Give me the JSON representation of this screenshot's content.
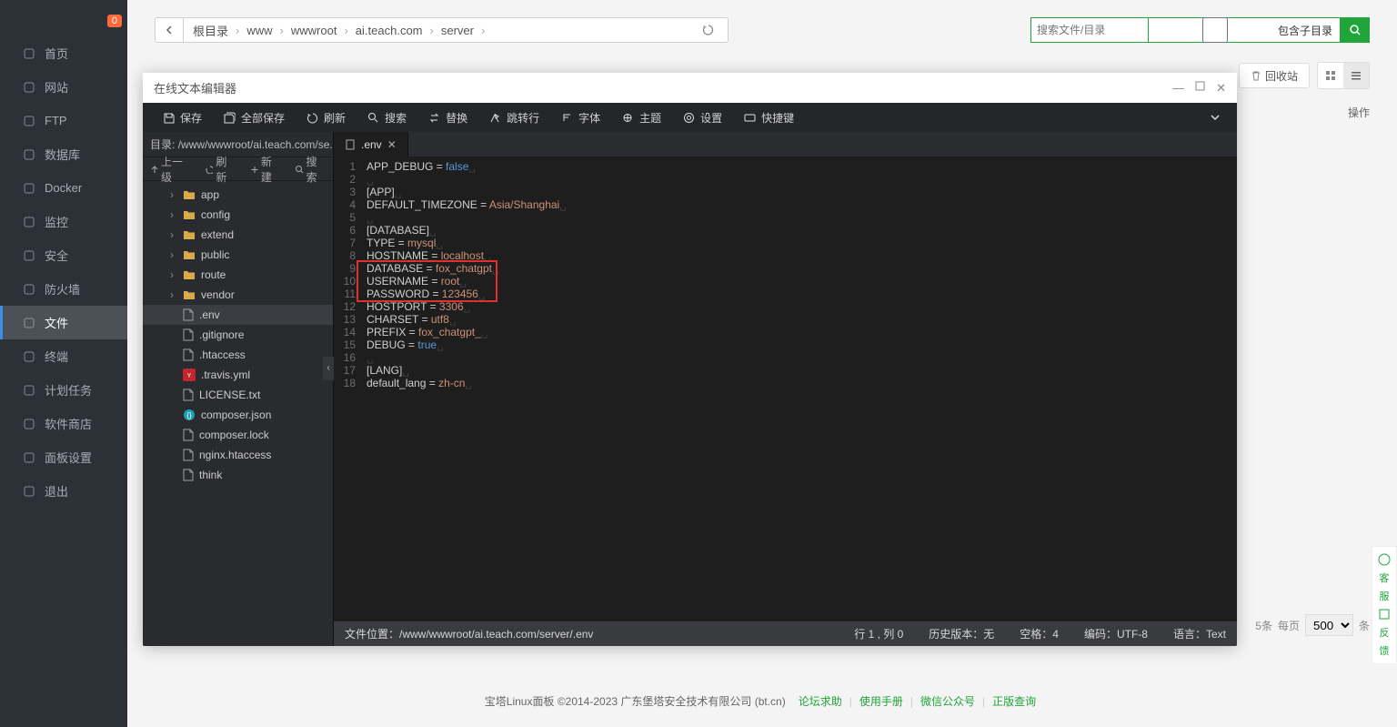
{
  "nav": {
    "badge": "0",
    "items": [
      {
        "label": "首页",
        "icon": "home-icon"
      },
      {
        "label": "网站",
        "icon": "globe-icon"
      },
      {
        "label": "FTP",
        "icon": "ftp-icon"
      },
      {
        "label": "数据库",
        "icon": "db-icon"
      },
      {
        "label": "Docker",
        "icon": "docker-icon"
      },
      {
        "label": "监控",
        "icon": "monitor-icon"
      },
      {
        "label": "安全",
        "icon": "shield-icon"
      },
      {
        "label": "防火墙",
        "icon": "firewall-icon"
      },
      {
        "label": "文件",
        "icon": "file-icon",
        "active": true
      },
      {
        "label": "终端",
        "icon": "terminal-icon"
      },
      {
        "label": "计划任务",
        "icon": "cron-icon"
      },
      {
        "label": "软件商店",
        "icon": "store-icon"
      },
      {
        "label": "面板设置",
        "icon": "settings-icon"
      },
      {
        "label": "退出",
        "icon": "logout-icon"
      }
    ]
  },
  "header": {
    "crumbs": [
      "根目录",
      "www",
      "wwwroot",
      "ai.teach.com",
      "server"
    ],
    "search_placeholder": "搜索文件/目录",
    "include_sub": "包含子目录"
  },
  "toolbar": {
    "trash": "回收站",
    "ops_label": "操作"
  },
  "footer_bar": {
    "count_suffix": "5条",
    "per_page_label": "每页",
    "per_page": "500",
    "unit": "条"
  },
  "copyright": {
    "text": "宝塔Linux面板 ©2014-2023 广东堡塔安全技术有限公司 (bt.cn)",
    "links": [
      "论坛求助",
      "使用手册",
      "微信公众号",
      "正版查询"
    ]
  },
  "feedback": [
    "客",
    "服",
    "反",
    "馈"
  ],
  "editor": {
    "title": "在线文本编辑器",
    "tools": [
      {
        "icon": "save-icon",
        "label": "保存"
      },
      {
        "icon": "save-all-icon",
        "label": "全部保存"
      },
      {
        "icon": "refresh-icon",
        "label": "刷新"
      },
      {
        "icon": "search-icon",
        "label": "搜索"
      },
      {
        "icon": "replace-icon",
        "label": "替换"
      },
      {
        "icon": "goto-icon",
        "label": "跳转行"
      },
      {
        "icon": "font-icon",
        "label": "字体"
      },
      {
        "icon": "theme-icon",
        "label": "主题"
      },
      {
        "icon": "settings-icon",
        "label": "设置"
      },
      {
        "icon": "hotkey-icon",
        "label": "快捷键"
      }
    ],
    "sidebar": {
      "path_label": "目录:",
      "path": "/www/wwwroot/ai.teach.com/se...",
      "ops": [
        "上一级",
        "刷新",
        "新建",
        "搜索"
      ],
      "tree": [
        {
          "type": "folder",
          "name": "app"
        },
        {
          "type": "folder",
          "name": "config"
        },
        {
          "type": "folder",
          "name": "extend"
        },
        {
          "type": "folder",
          "name": "public"
        },
        {
          "type": "folder",
          "name": "route"
        },
        {
          "type": "folder",
          "name": "vendor"
        },
        {
          "type": "file",
          "name": ".env",
          "selected": true
        },
        {
          "type": "file",
          "name": ".gitignore"
        },
        {
          "type": "file",
          "name": ".htaccess"
        },
        {
          "type": "yml",
          "name": ".travis.yml"
        },
        {
          "type": "file",
          "name": "LICENSE.txt"
        },
        {
          "type": "json",
          "name": "composer.json"
        },
        {
          "type": "file",
          "name": "composer.lock"
        },
        {
          "type": "file",
          "name": "nginx.htaccess"
        },
        {
          "type": "file",
          "name": "think"
        }
      ]
    },
    "tab": {
      "icon": "file-icon",
      "name": ".env"
    },
    "code": [
      {
        "t": "kv",
        "k": "APP_DEBUG",
        "v": "false",
        "bool": true
      },
      {
        "t": "blank"
      },
      {
        "t": "sec",
        "s": "[APP]"
      },
      {
        "t": "kv",
        "k": "DEFAULT_TIMEZONE",
        "v": "Asia/Shanghai"
      },
      {
        "t": "blank"
      },
      {
        "t": "sec",
        "s": "[DATABASE]"
      },
      {
        "t": "kv",
        "k": "TYPE",
        "v": "mysql"
      },
      {
        "t": "kv",
        "k": "HOSTNAME",
        "v": "localhost"
      },
      {
        "t": "kv",
        "k": "DATABASE",
        "v": "fox_chatgpt"
      },
      {
        "t": "kv",
        "k": "USERNAME",
        "v": "root"
      },
      {
        "t": "kv",
        "k": "PASSWORD",
        "v": "123456"
      },
      {
        "t": "kv",
        "k": "HOSTPORT",
        "v": "3306"
      },
      {
        "t": "kv",
        "k": "CHARSET",
        "v": "utf8"
      },
      {
        "t": "kv",
        "k": "PREFIX",
        "v": "fox_chatgpt_"
      },
      {
        "t": "kv",
        "k": "DEBUG",
        "v": "true",
        "bool": true
      },
      {
        "t": "blank"
      },
      {
        "t": "sec",
        "s": "[LANG]"
      },
      {
        "t": "kv",
        "k": "default_lang",
        "v": "zh-cn"
      }
    ],
    "highlight": {
      "from": 9,
      "to": 11
    },
    "status": {
      "path_label": "文件位置：",
      "path": "/www/wwwroot/ai.teach.com/server/.env",
      "cursor": "行 1 , 列 0",
      "history": "历史版本：无",
      "spaces": "空格：4",
      "encoding": "编码：UTF-8",
      "lang": "语言：Text"
    }
  }
}
